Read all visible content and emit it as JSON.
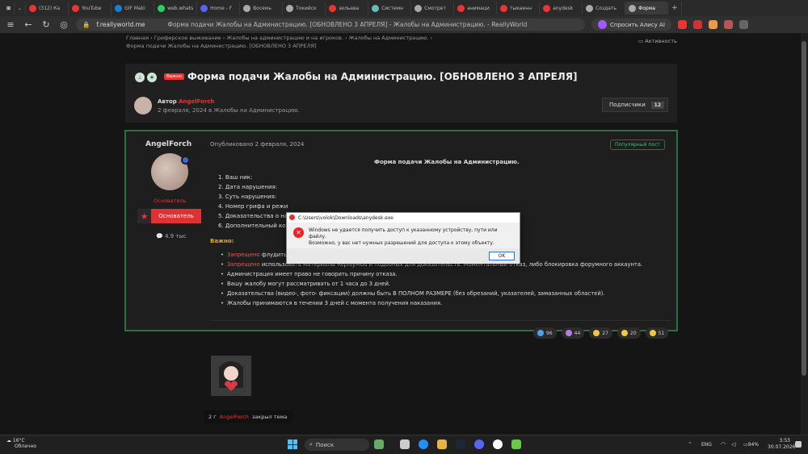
{
  "browser": {
    "tabs": [
      {
        "label": "(312) Ка",
        "color": "#e33"
      },
      {
        "label": "YouTube",
        "color": "#e33"
      },
      {
        "label": "GIF Maki",
        "color": "#1c7ed6"
      },
      {
        "label": "web.whats",
        "color": "#25d366"
      },
      {
        "label": "Home - F",
        "color": "#5865f2"
      },
      {
        "label": "Восемь",
        "color": "#aaa"
      },
      {
        "label": "Токийск",
        "color": "#aaa"
      },
      {
        "label": "зельева",
        "color": "#e33"
      },
      {
        "label": "Системн",
        "color": "#6bb"
      },
      {
        "label": "Смотрет",
        "color": "#aaa"
      },
      {
        "label": "анимаци",
        "color": "#e33"
      },
      {
        "label": "тыкаенн",
        "color": "#e33"
      },
      {
        "label": "anydesk",
        "color": "#e33"
      },
      {
        "label": "Создать",
        "color": "#aaa"
      },
      {
        "label": "Форма",
        "color": "#aaa",
        "active": true
      }
    ],
    "url": "f.reallyworld.me",
    "page_title": "Форма подачи Жалобы на Администрацию. [ОБНОВЛЕНО 3 АПРЕЛЯ] - Жалобы на Администрацию. - ReallyWorld",
    "alice_label": "Спросить Алису AI"
  },
  "breadcrumbs": {
    "line1": "Главная  ›  Гриферское выживание  ›  Жалобы на администрацию и на игроков.  ›  Жалобы на Администрацию.  ›",
    "line2": "Форма подачи Жалобы на Администрацию. [ОБНОВЛЕНО 3 АПРЕЛЯ]",
    "activity": "Активность"
  },
  "topic": {
    "badge": "Важно",
    "title": "Форма подачи Жалобы на Администрацию. [ОБНОВЛЕНО 3 АПРЕЛЯ]",
    "author_prefix": "Автор",
    "author": "AngelForch",
    "date_line": "2 февраля, 2024 в Жалобы на Администрацию.",
    "subscribe_label": "Подписчики",
    "subscribe_count": "12"
  },
  "post": {
    "username": "AngelForch",
    "role": "Основатель",
    "role_button": "Основатель",
    "messages": "4.9 тыс",
    "published": "Опубликовано 2 февраля, 2024",
    "popular": "Популярный пост",
    "form_title": "Форма подачи Жалобы на Администрацию.",
    "fields": [
      "1. Ваш ник:",
      "2. Дата нарушения:",
      "3. Суть нарушения:",
      "4. Номер грифа и режи",
      "5. Доказательства о на",
      "6. Дополнительный ком"
    ],
    "important": "Важно:",
    "rules": [
      {
        "red": "Запрещено",
        "text": " флудить жалобами (Вам заблокируют доступ к форуму)."
      },
      {
        "red": "Запрещено",
        "text": " использовать материалы ReplayMod и подобных для доказательств. Моментальный отказ, либо блокировка форумного аккаунта."
      },
      {
        "red": "",
        "text": "Администрация имеет право не говорить причину отказа."
      },
      {
        "red": "",
        "text": "Вашу жалобу могут рассматривать от 1 часа до 3  дней."
      },
      {
        "red": "",
        "text": "Доказательства (видео-, фото- фиксации) должны быть В ПОЛНОМ РАЗМЕРЕ (без обрезаний, указателей, замазанных областей)."
      },
      {
        "red": "",
        "text": "Жалобы принимаются в течении 3 дней с момента получения наказания."
      }
    ],
    "reactions": [
      {
        "count": "96",
        "color": "#4aa3e8"
      },
      {
        "count": "44",
        "color": "#b57ee0"
      },
      {
        "count": "27",
        "color": "#f5c542"
      },
      {
        "count": "20",
        "color": "#f5c542"
      },
      {
        "count": "51",
        "color": "#f5c542"
      }
    ]
  },
  "closed_notice": {
    "prefix": "2 г",
    "user": "AngelForch",
    "text": "закрыл тема"
  },
  "dialog": {
    "title": "C:\\Users\\volok\\Downloads\\anydesk.exe",
    "line1": "Windows не удается получить доступ к указанному устройству, пути или файлу.",
    "line2": "Возможно, у вас нет нужных разрешений для доступа к этому объекту.",
    "ok": "OK"
  },
  "taskbar": {
    "weather_temp": "16°C",
    "weather_desc": "Облачно",
    "search": "Поиск",
    "lang": "ENG",
    "battery": "94%",
    "time": "3:53",
    "date": "30.07.2026"
  }
}
